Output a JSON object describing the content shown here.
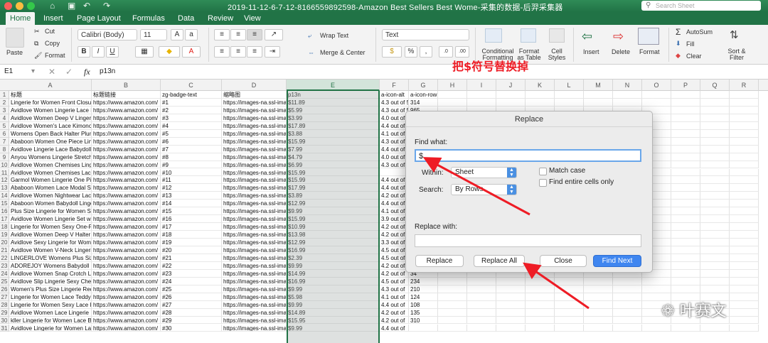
{
  "window": {
    "title": "2019-11-12-6-7-12-8166559892598-Amazon Best Sellers Best Wome-采集的数据-后羿采集器",
    "search_placeholder": "Search Sheet"
  },
  "tabs": [
    "Home",
    "Insert",
    "Page Layout",
    "Formulas",
    "Data",
    "Review",
    "View"
  ],
  "ribbon": {
    "paste": "Paste",
    "cut": "Cut",
    "copy": "Copy",
    "format": "Format",
    "font": "Calibri (Body)",
    "size": "11",
    "wrap": "Wrap Text",
    "merge": "Merge & Center",
    "numfmt": "Text",
    "cond": "Conditional Formatting",
    "fmt_table": "Format as Table",
    "cell_styles": "Cell Styles",
    "insert": "Insert",
    "delete": "Delete",
    "format2": "Format",
    "autosum": "AutoSum",
    "fill": "Fill",
    "clear": "Clear",
    "sort": "Sort & Filter"
  },
  "formula_bar": {
    "cell_ref": "E1",
    "fx": "fx",
    "content": "p13n"
  },
  "columns": [
    {
      "letter": "A",
      "w": 116
    },
    {
      "letter": "B",
      "w": 97
    },
    {
      "letter": "C",
      "w": 86
    },
    {
      "letter": "D",
      "w": 91
    },
    {
      "letter": "E",
      "w": 131
    },
    {
      "letter": "F",
      "w": 41
    },
    {
      "letter": "G",
      "w": 41
    },
    {
      "letter": "H",
      "w": 41
    },
    {
      "letter": "I",
      "w": 41
    },
    {
      "letter": "J",
      "w": 41
    },
    {
      "letter": "K",
      "w": 41
    },
    {
      "letter": "L",
      "w": 41
    },
    {
      "letter": "M",
      "w": 41
    },
    {
      "letter": "N",
      "w": 41
    },
    {
      "letter": "O",
      "w": 41
    },
    {
      "letter": "P",
      "w": 41
    },
    {
      "letter": "Q",
      "w": 41
    },
    {
      "letter": "R",
      "w": 41
    }
  ],
  "rows": [
    [
      "标题",
      "标题链接",
      "zg-badge-text",
      "缩略图",
      "p13n",
      "a-icon-alt",
      "a-icon-row"
    ],
    [
      "Lingerie for Women Front Closure",
      "https://www.amazon.com/",
      "#1",
      "https://images-na.ssl-ima",
      "$11.89",
      "4.3 out of 5",
      "314"
    ],
    [
      "Avidlove Women Lingerie Lace B",
      "https://www.amazon.com/",
      "#2",
      "https://images-na.ssl-ima",
      "$5.99",
      "4.3 out of 5",
      "965"
    ],
    [
      "Avidlove Women Deep V Lingerie",
      "https://www.amazon.com/",
      "#3",
      "https://images-na.ssl-ima",
      "$3.99",
      "4.0 out of",
      ""
    ],
    [
      "Avidlove Women's Lace Kimono",
      "https://www.amazon.com/",
      "#4",
      "https://images-na.ssl-ima",
      "$17.89",
      "4.4 out of",
      ""
    ],
    [
      "Womens Open Back Halter Plunge",
      "https://www.amazon.com/",
      "#5",
      "https://images-na.ssl-ima",
      "$3.88",
      "4.1 out of",
      ""
    ],
    [
      "Ababoon Women One Piece Lingerie",
      "https://www.amazon.com/",
      "#6",
      "https://images-na.ssl-ima",
      "$15.99",
      "4.3 out of",
      ""
    ],
    [
      "Avidlove Lingerie Lace Babydoll",
      "https://www.amazon.com/",
      "#7",
      "https://images-na.ssl-ima",
      "$7.99",
      "4.4 out of",
      ""
    ],
    [
      "Anyou Womens Lingerie Stretch",
      "https://www.amazon.com/",
      "#8",
      "https://images-na.ssl-ima",
      "$4.79",
      "4.0 out of",
      ""
    ],
    [
      "Avidlove Women Chemises Linge",
      "https://www.amazon.com/",
      "#9",
      "https://images-na.ssl-ima",
      "$6.99",
      "4.3 out of",
      ""
    ],
    [
      "Avidlove Women Chemises Lace",
      "https://www.amazon.com/",
      "#10",
      "https://images-na.ssl-ima",
      "$15.99",
      "",
      ""
    ],
    [
      "Garmol Women Lingerie One Piece",
      "https://www.amazon.com/",
      "#11",
      "https://images-na.ssl-ima",
      "$15.99",
      "4.4 out of",
      ""
    ],
    [
      "Ababoon Women Lace Modal Sle",
      "https://www.amazon.com/",
      "#12",
      "https://images-na.ssl-ima",
      "$17.99",
      "4.4 out of",
      ""
    ],
    [
      "Avidlove Women Nightwear Lace",
      "https://www.amazon.com/",
      "#13",
      "https://images-na.ssl-ima",
      "$3.89",
      "4.2 out of",
      ""
    ],
    [
      "Ababoon Women Babydoll Linge",
      "https://www.amazon.com/",
      "#14",
      "https://images-na.ssl-ima",
      "$12.99",
      "4.4 out of",
      ""
    ],
    [
      "Plus Size Lingerie for Women Sex",
      "https://www.amazon.com/",
      "#15",
      "https://images-na.ssl-ima",
      "$9.99",
      "4.1 out of",
      ""
    ],
    [
      "Avidlove Women Lingerie Set wit",
      "https://www.amazon.com/",
      "#16",
      "https://images-na.ssl-ima",
      "$15.99",
      "3.9 out of",
      ""
    ],
    [
      "Lingerie for Women Sexy One-Pie",
      "https://www.amazon.com/",
      "#17",
      "https://images-na.ssl-ima",
      "$10.99",
      "4.2 out of",
      ""
    ],
    [
      "Avidlove Women Deep V Halter",
      "https://www.amazon.com/",
      "#18",
      "https://images-na.ssl-ima",
      "$13.98",
      "4.2 out of",
      ""
    ],
    [
      "Avidlove Sexy Lingerie for Wome",
      "https://www.amazon.com/",
      "#19",
      "https://images-na.ssl-ima",
      "$12.99",
      "3.3 out of",
      ""
    ],
    [
      "Avidlove Women V-Neck Lingerie",
      "https://www.amazon.com/",
      "#20",
      "https://images-na.ssl-ima",
      "$16.99",
      "4.5 out of",
      ""
    ],
    [
      "LINGERLOVE Womens Plus Size S",
      "https://www.amazon.com/",
      "#21",
      "https://images-na.ssl-ima",
      "$2.39",
      "4.5 out of",
      ""
    ],
    [
      "ADOREJOY Womens Babydoll Lin",
      "https://www.amazon.com/",
      "#22",
      "https://images-na.ssl-ima",
      "$9.99",
      "4.2 out of",
      "1,358"
    ],
    [
      "Avidlove Women Snap Crotch Lin",
      "https://www.amazon.com/",
      "#23",
      "https://images-na.ssl-ima",
      "$14.99",
      "4.2 out of",
      "34"
    ],
    [
      "Avidlove Slip Lingerie Sexy Chem",
      "https://www.amazon.com/",
      "#24",
      "https://images-na.ssl-ima",
      "$16.99",
      "4.5 out of",
      "234"
    ],
    [
      "Women's Plus Size Lingerie Red",
      "https://www.amazon.com/",
      "#25",
      "https://images-na.ssl-ima",
      "$9.99",
      "4.3 out of",
      "210"
    ],
    [
      "Lingerie for Women Lace Teddy",
      "https://www.amazon.com/",
      "#26",
      "https://images-na.ssl-ima",
      "$5.98",
      "4.1 out of",
      "124"
    ],
    [
      "Lingerie for Women Sexy Lace Ki",
      "https://www.amazon.com/",
      "#27",
      "https://images-na.ssl-ima",
      "$9.99",
      "4.4 out of",
      "108"
    ],
    [
      "Avidlove Women Lace Lingerie",
      "https://www.amazon.com/",
      "#28",
      "https://images-na.ssl-ima",
      "$14.89",
      "4.2 out of",
      "135"
    ],
    [
      "kller Lingerie for Women Lace Ba",
      "https://www.amazon.com/",
      "#29",
      "https://images-na.ssl-ima",
      "$15.95",
      "4.2 out of",
      "310"
    ],
    [
      "Avidlove Lingerie for Women Lac",
      "https://www.amazon.com/",
      "#30",
      "https://images-na.ssl-ima",
      "$9.99",
      "4.4 out of",
      ""
    ]
  ],
  "dialog": {
    "title": "Replace",
    "find_label": "Find what:",
    "find_value": "$",
    "within_label": "Within:",
    "within_value": "Sheet",
    "search_label": "Search:",
    "search_value": "By Rows",
    "match_case": "Match case",
    "entire_cells": "Find entire cells only",
    "replace_label": "Replace with:",
    "replace_value": "",
    "btn_replace": "Replace",
    "btn_replace_all": "Replace All",
    "btn_close": "Close",
    "btn_find_next": "Find Next"
  },
  "annotation": "把$符号替换掉",
  "watermark": "叶赛文",
  "colors": {
    "excel_green": "#217346",
    "annot_red": "#ee1c25",
    "primary_blue": "#3f86f0"
  }
}
